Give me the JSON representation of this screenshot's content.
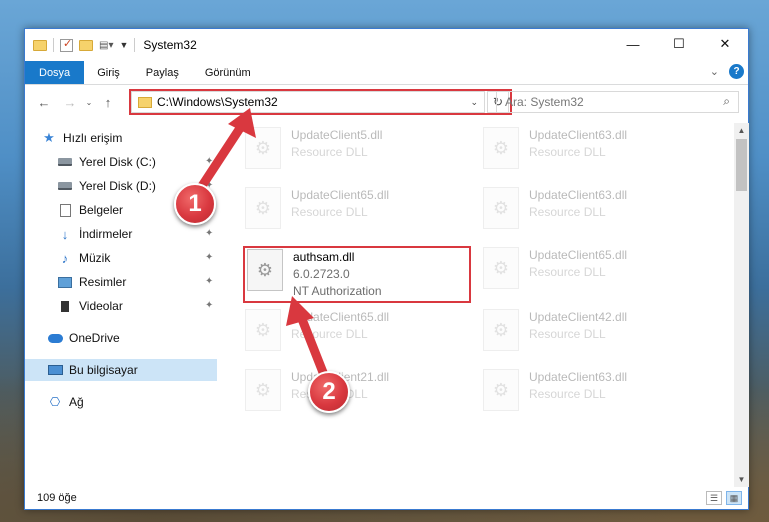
{
  "window": {
    "title": "System32",
    "controls": {
      "minimize": "—",
      "maximize": "☐",
      "close": "✕"
    }
  },
  "ribbon": {
    "tabs": [
      {
        "label": "Dosya",
        "active": true
      },
      {
        "label": "Giriş",
        "active": false
      },
      {
        "label": "Paylaş",
        "active": false
      },
      {
        "label": "Görünüm",
        "active": false
      }
    ],
    "help": "?"
  },
  "address_bar": {
    "path": "C:\\Windows\\System32",
    "search_placeholder": "Ara: System32"
  },
  "nav_pane": {
    "quick_access": "Hızlı erişim",
    "items": [
      {
        "label": "Yerel Disk (C:)",
        "icon": "disk-icon",
        "pinned": true
      },
      {
        "label": "Yerel Disk (D:)",
        "icon": "disk-icon",
        "pinned": true
      },
      {
        "label": "Belgeler",
        "icon": "documents-icon",
        "pinned": true
      },
      {
        "label": "İndirmeler",
        "icon": "downloads-icon",
        "pinned": true
      },
      {
        "label": "Müzik",
        "icon": "music-icon",
        "pinned": true
      },
      {
        "label": "Resimler",
        "icon": "pictures-icon",
        "pinned": true
      },
      {
        "label": "Videolar",
        "icon": "videos-icon",
        "pinned": true
      }
    ],
    "onedrive": "OneDrive",
    "this_pc": "Bu bilgisayar",
    "network": "Ağ"
  },
  "files": [
    {
      "name": "UpdateClient5.dll",
      "desc": "Resource DLL",
      "faded": true
    },
    {
      "name": "UpdateClient63.dll",
      "desc": "Resource DLL",
      "faded": true
    },
    {
      "name": "UpdateClient65.dll",
      "desc": "Resource DLL",
      "faded": true
    },
    {
      "name": "UpdateClient63.dll",
      "desc": "Resource DLL",
      "faded": true
    },
    {
      "name": "authsam.dll",
      "version": "6.0.2723.0",
      "desc": "NT Authorization",
      "faded": false
    },
    {
      "name": "UpdateClient65.dll",
      "desc": "Resource DLL",
      "faded": true
    },
    {
      "name": "UpdateClient65.dll",
      "desc": "Resource DLL",
      "faded": true
    },
    {
      "name": "UpdateClient42.dll",
      "desc": "Resource DLL",
      "faded": true
    },
    {
      "name": "UpdateClient21.dll",
      "desc": "Resource DLL",
      "faded": true
    },
    {
      "name": "UpdateClient63.dll",
      "desc": "Resource DLL",
      "faded": true
    }
  ],
  "status_bar": {
    "item_count": "109 öğe"
  },
  "annotations": {
    "badge1": "1",
    "badge2": "2",
    "color": "#d9383f"
  }
}
